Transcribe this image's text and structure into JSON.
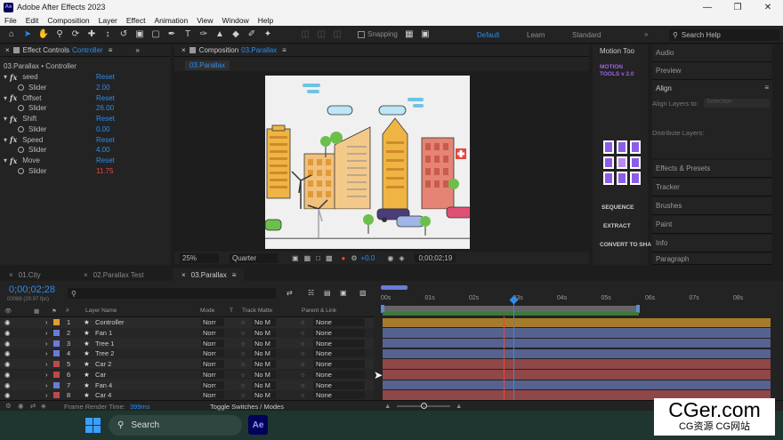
{
  "app": {
    "logo_text": "Ae",
    "title": "Adobe After Effects 2023"
  },
  "menu": [
    "File",
    "Edit",
    "Composition",
    "Layer",
    "Effect",
    "Animation",
    "View",
    "Window",
    "Help"
  ],
  "toolbar": {
    "snapping_label": "Snapping",
    "workspaces": [
      "Default",
      "Learn",
      "Standard"
    ],
    "search_placeholder": "Search Help"
  },
  "effect_controls": {
    "tab_label": "Effect Controls",
    "tab_layer": "Controller",
    "header": "03.Parallax • Controller",
    "effects": [
      {
        "name": "seed",
        "reset": "Reset",
        "slider_label": "Slider",
        "value": "2.00",
        "value_red": false
      },
      {
        "name": "Offset",
        "reset": "Reset",
        "slider_label": "Slider",
        "value": "26.00",
        "value_red": false
      },
      {
        "name": "Shift",
        "reset": "Reset",
        "slider_label": "Slider",
        "value": "0.00",
        "value_red": false
      },
      {
        "name": "Speed",
        "reset": "Reset",
        "slider_label": "Slider",
        "value": "4.00",
        "value_red": false
      },
      {
        "name": "Move",
        "reset": "Reset",
        "slider_label": "Slider",
        "value": "11.75",
        "value_red": true
      }
    ]
  },
  "composition": {
    "tab_prefix": "Composition",
    "tab_name": "03.Parallax",
    "sub_tab": "03.Parallax",
    "zoom": "25%",
    "resolution": "Quarter",
    "exposure": "+0.0",
    "timecode": "0;00;02;19"
  },
  "right_panel": {
    "motion_tools_tab": "Motion Too",
    "motion_tools_title": "MOTION TOOLS v 2.0",
    "sequence": "SEQUENCE",
    "extract": "EXTRACT",
    "convert": "CONVERT TO SHA",
    "audio": "Audio",
    "preview": "Preview",
    "align": "Align",
    "align_layers_to": "Align Layers to:",
    "align_target": "Selection",
    "distribute_layers": "Distribute Layers:",
    "effects_presets": "Effects & Presets",
    "tracker": "Tracker",
    "brushes": "Brushes",
    "paint": "Paint",
    "info": "Info",
    "paragraph": "Paragraph"
  },
  "timeline": {
    "tabs": [
      "01.City",
      "02.Parallax Test",
      "03.Parallax"
    ],
    "active_tab": 2,
    "timecode": "0;00;02;28",
    "fps": "00088 (29.97 fps)",
    "search_placeholder": "",
    "columns": [
      "#",
      "Layer Name",
      "Mode",
      "T",
      "Track Matte",
      "Parent & Link"
    ],
    "ruler": [
      "00s",
      "01s",
      "02s",
      "03s",
      "04s",
      "05s",
      "06s",
      "07s",
      "08s"
    ],
    "layers": [
      {
        "num": "1",
        "name": "Controller",
        "mode": "Norr",
        "matte": "No M",
        "parent": "None",
        "label": "#e0a030",
        "bar": "#a67b2a"
      },
      {
        "num": "2",
        "name": "Fan 1",
        "mode": "Norr",
        "matte": "No M",
        "parent": "None",
        "label": "#6a7bd8",
        "bar": "#56628f"
      },
      {
        "num": "3",
        "name": "Tree 1",
        "mode": "Norr",
        "matte": "No M",
        "parent": "None",
        "label": "#6a7bd8",
        "bar": "#56628f"
      },
      {
        "num": "4",
        "name": "Tree 2",
        "mode": "Norr",
        "matte": "No M",
        "parent": "None",
        "label": "#6a7bd8",
        "bar": "#56628f"
      },
      {
        "num": "5",
        "name": "Car 2",
        "mode": "Norr",
        "matte": "No M",
        "parent": "None",
        "label": "#c0484a",
        "bar": "#8f4747"
      },
      {
        "num": "6",
        "name": "Car",
        "mode": "Norr",
        "matte": "No M",
        "parent": "None",
        "label": "#c0484a",
        "bar": "#8f4747"
      },
      {
        "num": "7",
        "name": "Fan 4",
        "mode": "Norr",
        "matte": "No M",
        "parent": "None",
        "label": "#6a7bd8",
        "bar": "#56628f"
      },
      {
        "num": "8",
        "name": "Car 4",
        "mode": "Norr",
        "matte": "No M",
        "parent": "None",
        "label": "#c0484a",
        "bar": "#8f4747"
      }
    ],
    "frame_render_label": "Frame Render Time:",
    "frame_render_value": "399ms",
    "toggle_label": "Toggle Switches / Modes"
  },
  "taskbar": {
    "search": "Search"
  },
  "watermark": {
    "main": "CGer.com",
    "sub": "CG资源 CG网站"
  },
  "colors": {
    "accent": "#2d8ceb",
    "error_value": "#e8453c",
    "playhead": "#2d8ceb",
    "work_area": "#5b8ad6"
  }
}
